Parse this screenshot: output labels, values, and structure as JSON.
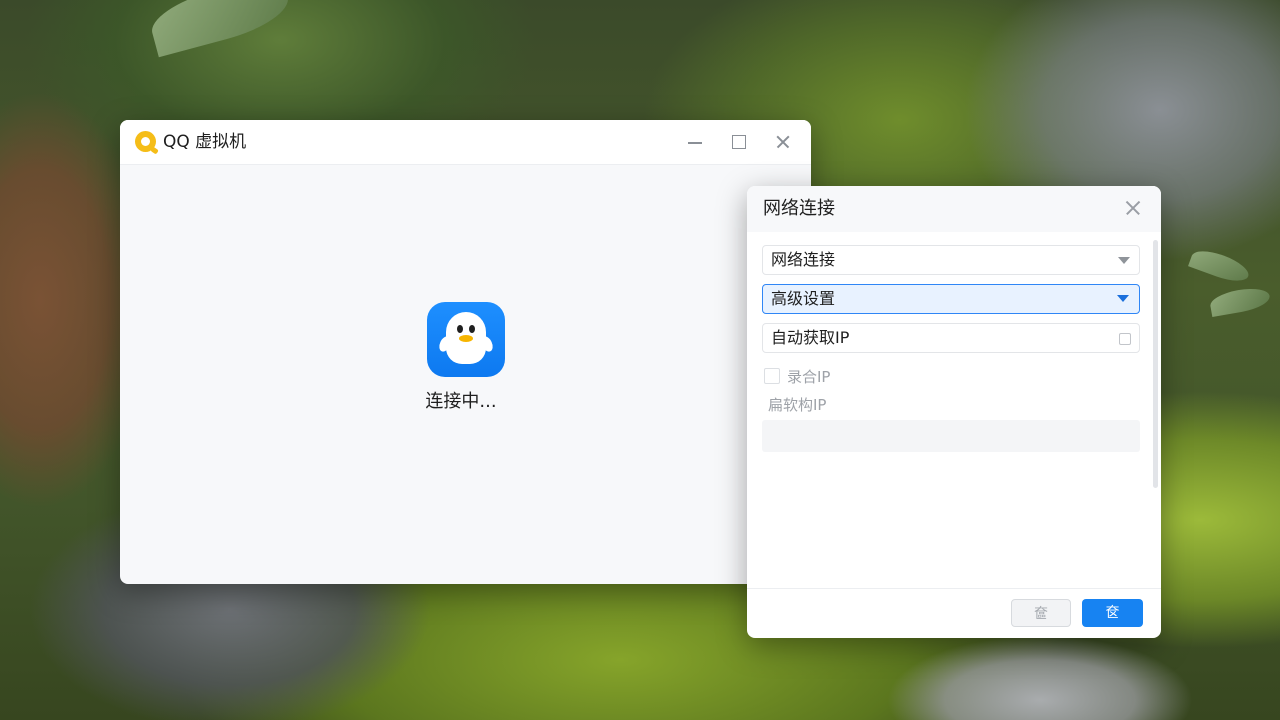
{
  "main_window": {
    "title": "QQ 虚拟机",
    "status_text": "连接中..."
  },
  "network_dialog": {
    "title": "网络连接",
    "select_network": "网络连接",
    "select_advanced": "高级设置",
    "ip_mode": "自动获取IP",
    "checkbox_label": "录合IP",
    "static_ip_label": "扁软构IP",
    "cancel_label": "奩",
    "ok_label": "奁"
  },
  "colors": {
    "accent": "#1783f2",
    "qq_blue": "#0d79f0",
    "logo_yellow": "#f5bd18",
    "selected_bg": "#e8f2ff"
  },
  "icons": [
    "qq-logo-icon",
    "minimize-icon",
    "maximize-icon",
    "close-icon",
    "qq-penguin-icon",
    "dropdown-caret-icon",
    "calculator-icon",
    "dialog-close-icon"
  ]
}
